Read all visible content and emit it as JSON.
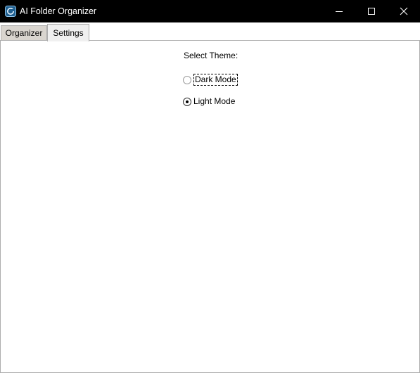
{
  "window": {
    "title": "AI Folder Organizer",
    "icon": "app-folder-icon"
  },
  "tabs": [
    {
      "label": "Organizer",
      "selected": false
    },
    {
      "label": "Settings",
      "selected": true
    }
  ],
  "settings": {
    "theme_label": "Select Theme:",
    "options": [
      {
        "label": "Dark Mode",
        "checked": false,
        "focused": true
      },
      {
        "label": "Light Mode",
        "checked": true,
        "focused": false
      }
    ]
  },
  "colors": {
    "titlebar_bg": "#000000",
    "titlebar_text": "#ffffff",
    "tab_active_bg": "#f0f0f0",
    "tab_inactive_bg": "#d9d5cf",
    "panel_bg": "#ffffff"
  }
}
